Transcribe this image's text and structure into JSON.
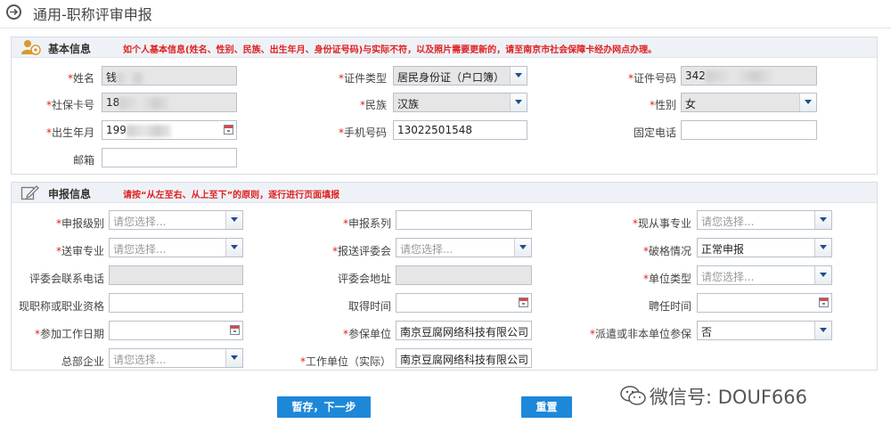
{
  "header": {
    "title": "通用-职称评审申报"
  },
  "basic": {
    "title": "基本信息",
    "notice": "如个人基本信息(姓名、性别、民族、出生年月、身份证号码)与实际不符，以及照片需要更新的，请至南京市社会保障卡经办网点办理。",
    "name_label": "*姓名",
    "name_value": "钱",
    "idtype_label": "*证件类型",
    "idtype_value": "居民身份证（户口簿）",
    "idno_label": "*证件号码",
    "idno_value": "342",
    "sscard_label": "*社保卡号",
    "sscard_value": "18",
    "nation_label": "*民族",
    "nation_value": "汉族",
    "gender_label": "*性别",
    "gender_value": "女",
    "birth_label": "*出生年月",
    "birth_value": "199",
    "phone_label": "*手机号码",
    "phone_value": "13022501548",
    "tel_label": "固定电话",
    "tel_value": "",
    "email_label": "邮箱",
    "email_value": ""
  },
  "apply": {
    "title": "申报信息",
    "notice": "请按“从左至右、从上至下”的原则，逐行进行页面填报",
    "level_label": "*申报级别",
    "level_value": "请您选择...",
    "series_label": "*申报系列",
    "series_value": "",
    "major_label": "*现从事专业",
    "major_value": "请您选择...",
    "reviewmajor_label": "*送审专业",
    "reviewmajor_value": "请您选择...",
    "committee_label": "*报送评委会",
    "committee_value": "请您选择...",
    "exception_label": "*破格情况",
    "exception_value": "正常申报",
    "committee_phone_label": "评委会联系电话",
    "committee_phone_value": "",
    "committee_addr_label": "评委会地址",
    "committee_addr_value": "",
    "unit_type_label": "*单位类型",
    "unit_type_value": "请您选择...",
    "current_title_label": "现职称或职业资格",
    "current_title_value": "",
    "obtain_time_label": "取得时间",
    "obtain_time_value": "",
    "hire_time_label": "聘任时间",
    "hire_time_value": "",
    "work_date_label": "*参加工作日期",
    "work_date_value": "",
    "insured_unit_label": "*参保单位",
    "insured_unit_value": "南京豆腐网络科技有限公司",
    "dispatch_label": "*派遣或非本单位参保",
    "dispatch_value": "否",
    "hq_label": "总部企业",
    "hq_value": "请您选择...",
    "work_unit_label": "*工作单位（实际）",
    "work_unit_value": "南京豆腐网络科技有限公司"
  },
  "buttons": {
    "save_next": "暂存，下一步",
    "reset": "重置"
  },
  "watermark": {
    "text": "微信号: DOUF666"
  },
  "colors": {
    "required": "#e02020",
    "button": "#1e88d8",
    "section_header": "#eef2f7"
  }
}
